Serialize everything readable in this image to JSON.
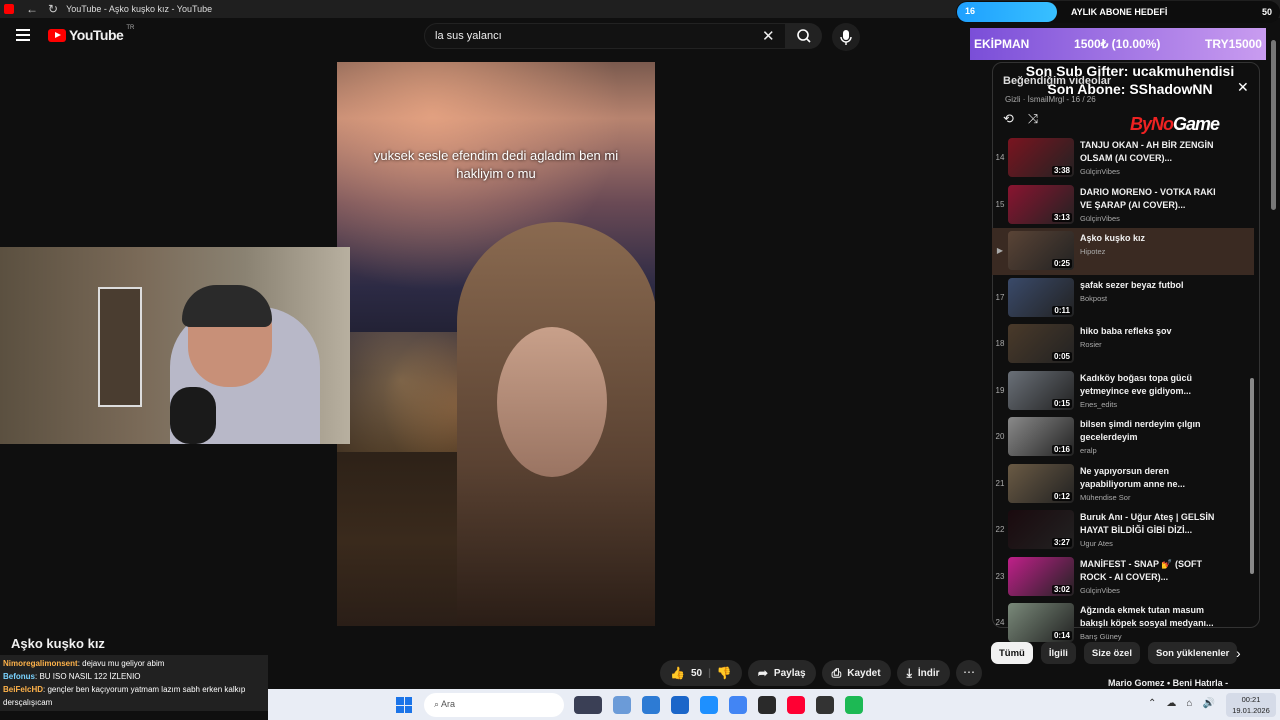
{
  "browser": {
    "tab_title": "YouTube - Aşko kuşko kız - YouTube",
    "nav_back": "←",
    "nav_reload": "↻",
    "window_controls": [
      "—",
      "❐",
      "✕"
    ]
  },
  "youtube": {
    "logo_text": "YouTube",
    "logo_country": "TR",
    "search_value": "la sus yalancı",
    "clear_icon": "✕",
    "search_icon": "⌕",
    "mic_icon": "🎤"
  },
  "overlay": {
    "goal_count": "16",
    "goal_label": "AYLIK ABONE HEDEFİ",
    "goal_target": "50",
    "ekipman_label": "EKİPMAN",
    "ekipman_value": "1500₺ (10.00%)",
    "ekipman_target": "TRY15000",
    "sub_gifter": "Son Sub Gifter: ucakmuhendisi",
    "son_abone": "Son Abone: SShadowNN",
    "brand_left": "ByNo",
    "brand_right": "Game"
  },
  "video": {
    "caption": "yuksek sesle efendim dedi agladim ben mi hakliyim o mu",
    "title": "Aşko kuşko kız"
  },
  "chat": [
    {
      "user": "Nimoregalimonsent",
      "msg": ": dejavu mu geliyor abim"
    },
    {
      "user": "Befonus",
      "msg": ": BU ISO NASIL 122 İZLENIO"
    },
    {
      "user": "BeiFelcHD",
      "msg": ": gençler ben kaçıyorum yatmam lazım sabh erken kalkıp dersçalışıcam"
    }
  ],
  "actions": {
    "like_count": "50",
    "like_icon": "👍",
    "dislike_icon": "👎",
    "share_label": "Paylaş",
    "share_icon": "➦",
    "save_label": "Kaydet",
    "save_icon": "⎙",
    "download_label": "İndir",
    "download_icon": "⤓",
    "more_icon": "⋯"
  },
  "playlist": {
    "title": "Beğendiğim videolar",
    "subtitle": "Gizli · İsmailMrgl - 16 / 26",
    "close_icon": "✕",
    "loop_icon": "⟲",
    "shuffle_icon": "⤨",
    "items": [
      {
        "index": "14",
        "title": "TANJU OKAN - AH BİR ZENGİN OLSAM (AI COVER)...",
        "channel": "GülçinVibes",
        "duration": "3:38",
        "color": "#7a1420"
      },
      {
        "index": "15",
        "title": "DARIO MORENO - VOTKA RAKI VE ŞARAP (AI COVER)...",
        "channel": "GülçinVibes",
        "duration": "3:13",
        "color": "#8a1430"
      },
      {
        "index": "▶",
        "title": "Aşko kuşko kız",
        "channel": "Hipotez",
        "duration": "0:25",
        "color": "#5a4436"
      },
      {
        "index": "17",
        "title": "şafak sezer beyaz futbol",
        "channel": "Bokpost",
        "duration": "0:11",
        "color": "#3a4a6a"
      },
      {
        "index": "18",
        "title": "hiko baba refleks şov",
        "channel": "Rosier",
        "duration": "0:05",
        "color": "#4a3a2a"
      },
      {
        "index": "19",
        "title": "Kadıköy boğası topa gücü yetmeyince eve gidiyom...",
        "channel": "Enes_edits",
        "duration": "0:15",
        "color": "#6a7078"
      },
      {
        "index": "20",
        "title": "bilsen şimdi nerdeyim çılgın gecelerdeyim",
        "channel": "eralp",
        "duration": "0:16",
        "color": "#8a8a8a"
      },
      {
        "index": "21",
        "title": "Ne yapıyorsun deren yapabiliyorum anne ne...",
        "channel": "Mühendise Sor",
        "duration": "0:12",
        "color": "#6a5a44"
      },
      {
        "index": "22",
        "title": "Buruk Anı - Uğur Ateş | GELSİN HAYAT BİLDİĞİ GİBİ DİZİ...",
        "channel": "Ugur Ates",
        "duration": "3:27",
        "color": "#1a0a0e"
      },
      {
        "index": "23",
        "title": "MANİFEST - SNAP 💅 (SOFT ROCK - AI COVER)...",
        "channel": "GülçinVibes",
        "duration": "3:02",
        "color": "#c0208a"
      },
      {
        "index": "24",
        "title": "Ağzında ekmek tutan masum bakışlı köpek sosyal medyanı...",
        "channel": "Barış Güney",
        "duration": "0:14",
        "color": "#7a8a7a"
      }
    ]
  },
  "chips": [
    "Tümü",
    "İlgili",
    "Size özel",
    "Son yüklenenler"
  ],
  "chip_next_icon": "›",
  "next_video_title": "Mario Gomez • Beni Hatırla -",
  "taskbar": {
    "search_placeholder": "Ara",
    "tray_icons": [
      "⌃",
      "☁",
      "⌂",
      "🔊"
    ],
    "time": "00:21",
    "date": "19.01.2026",
    "app_colors": [
      "#3a3f55",
      "#6b9bd8",
      "#2d7bd4",
      "#1b66c9",
      "#1e90ff",
      "#4285f4",
      "#2a2a2a",
      "#ff0033",
      "#333",
      "#1db954"
    ]
  }
}
